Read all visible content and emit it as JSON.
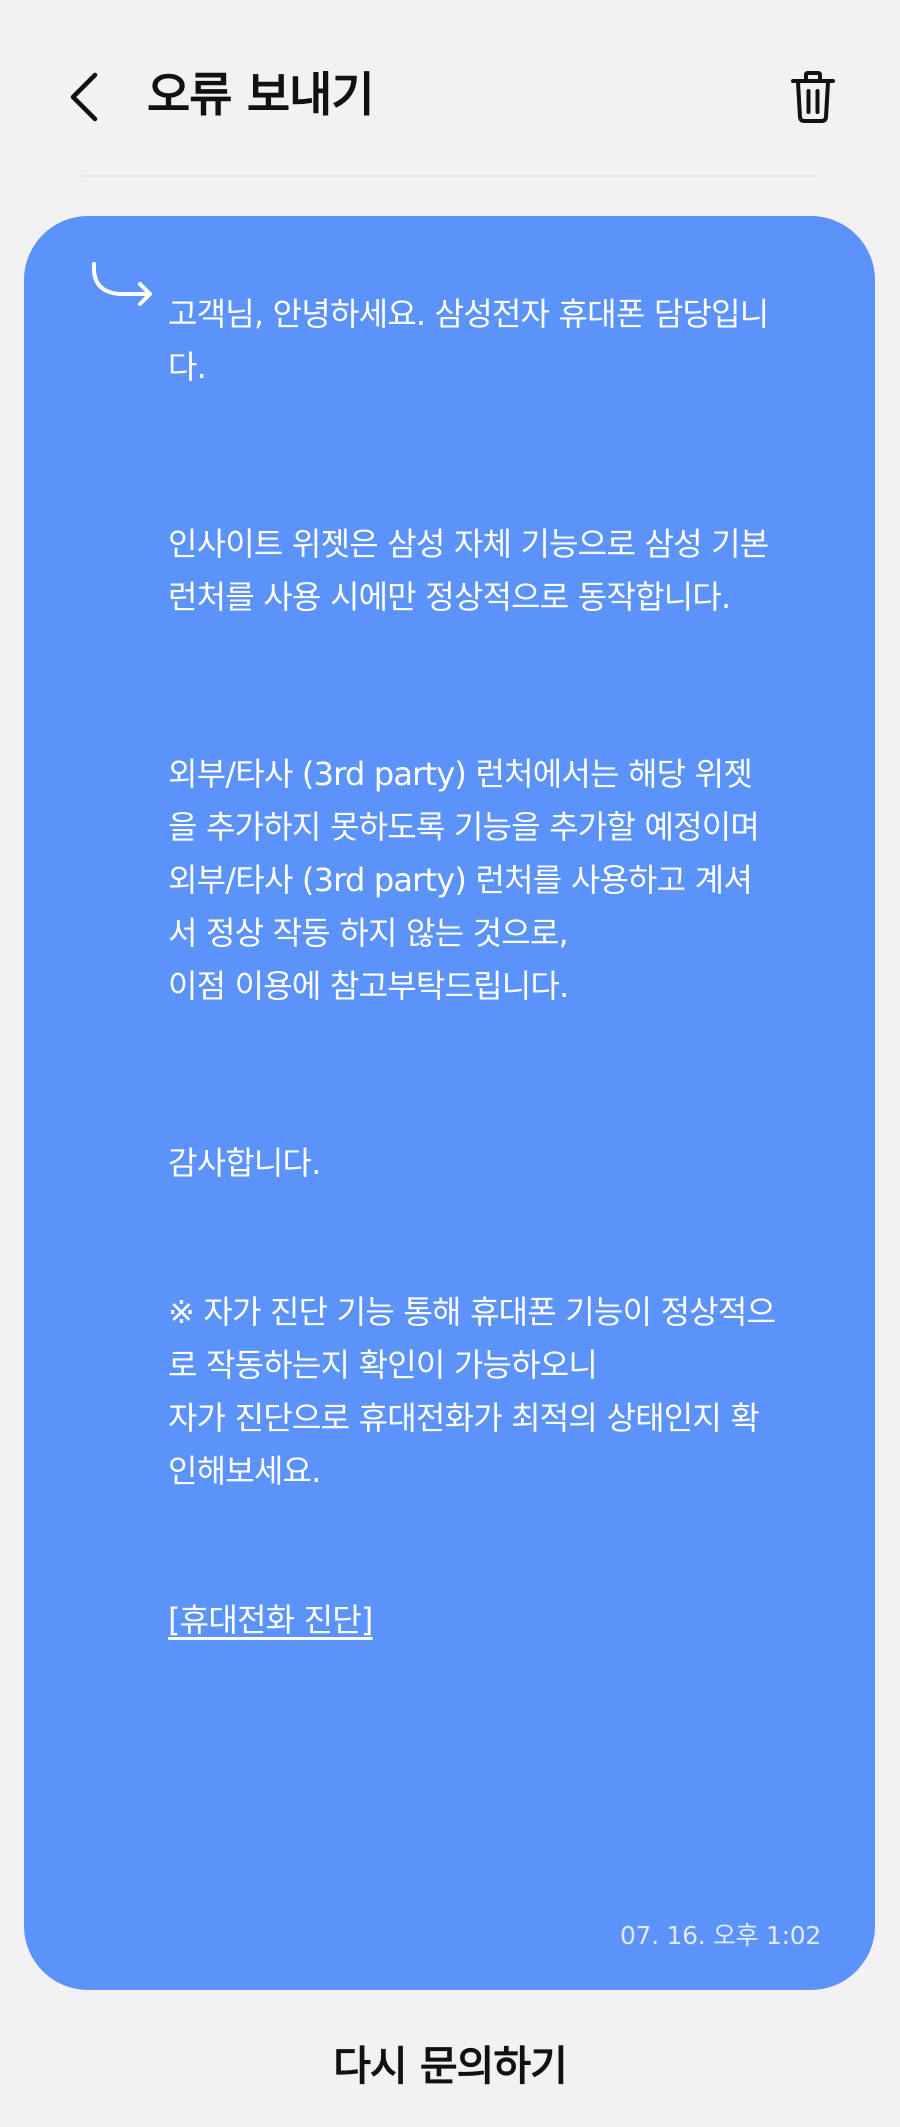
{
  "header": {
    "title": "오류 보내기",
    "back_icon": "chevron-left-icon",
    "delete_icon": "trash-icon"
  },
  "message": {
    "reply_icon": "reply-arrow-icon",
    "paragraph1": [
      "고객님, 안녕하세요. 삼성전자 휴대폰 담당입니",
      "다."
    ],
    "paragraph2": [
      "인사이트 위젯은 삼성 자체 기능으로 삼성 기본",
      "런처를 사용 시에만 정상적으로 동작합니다."
    ],
    "paragraph3": [
      "외부/타사 (3rd party) 런처에서는 해당 위젯",
      "을 추가하지 못하도록 기능을 추가할 예정이며",
      "외부/타사 (3rd party) 런처를 사용하고 계셔",
      "서 정상 작동 하지 않는 것으로,",
      "이점 이용에 참고부탁드립니다."
    ],
    "paragraph4": [
      "감사합니다."
    ],
    "paragraph5": [
      "※ 자가 진단 기능 통해 휴대폰 기능이 정상적으",
      "로 작동하는지 확인이 가능하오니",
      "자가 진단으로 휴대전화가 최적의 상태인지 확",
      "인해보세요."
    ],
    "link_label": "[휴대전화 진단]",
    "timestamp": "07. 16. 오후 1:02"
  },
  "footer": {
    "reask_label": "다시 문의하기"
  },
  "colors": {
    "background": "#f2f2f4",
    "bubble": "#5b93fa",
    "text_on_bubble": "#ffffff"
  }
}
